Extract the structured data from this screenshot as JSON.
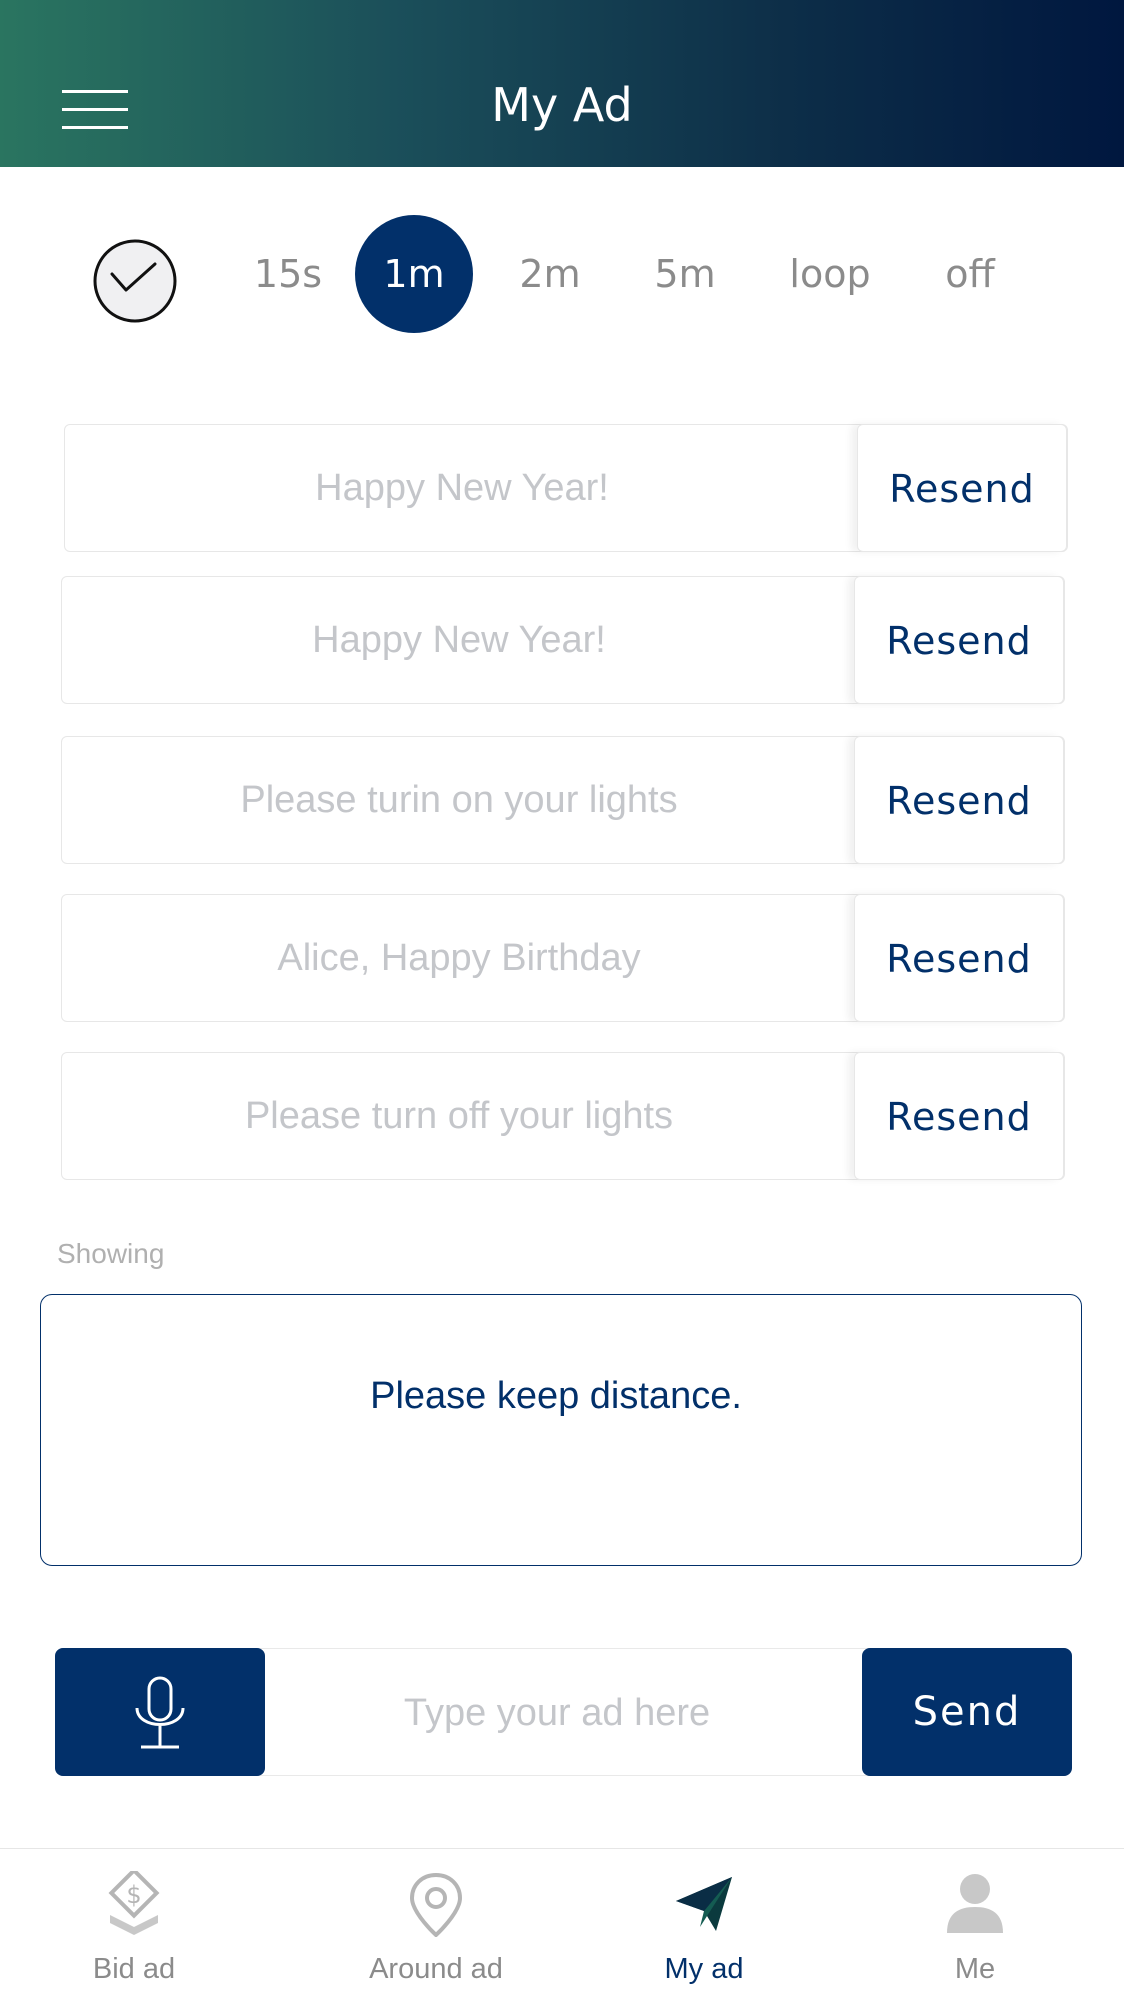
{
  "header": {
    "title": "My Ad"
  },
  "timer": {
    "options": [
      "15s",
      "1m",
      "2m",
      "5m",
      "loop",
      "off"
    ],
    "selected": "1m"
  },
  "messages": [
    {
      "text": "Happy New Year!",
      "action": "Resend"
    },
    {
      "text": "Happy New Year!",
      "action": "Resend"
    },
    {
      "text": "Please turin on your lights",
      "action": "Resend"
    },
    {
      "text": "Alice, Happy Birthday",
      "action": "Resend"
    },
    {
      "text": "Please turn off your lights",
      "action": "Resend"
    }
  ],
  "showing": {
    "label": "Showing",
    "text": "Please keep distance."
  },
  "composer": {
    "placeholder": "Type your ad here",
    "value": "",
    "send_label": "Send",
    "mic_icon": "microphone-icon"
  },
  "tabs": [
    {
      "label": "Bid ad",
      "icon": "bid-ad-icon",
      "active": false
    },
    {
      "label": "Around ad",
      "icon": "location-pin-icon",
      "active": false
    },
    {
      "label": "My ad",
      "icon": "paper-plane-icon",
      "active": true
    },
    {
      "label": "Me",
      "icon": "person-icon",
      "active": false
    }
  ],
  "colors": {
    "primary": "#02306a",
    "header_gradient_start": "#2a7560",
    "header_gradient_end": "#00173f",
    "muted_text": "#8b8b8b",
    "placeholder_text": "#c4c6ca"
  }
}
